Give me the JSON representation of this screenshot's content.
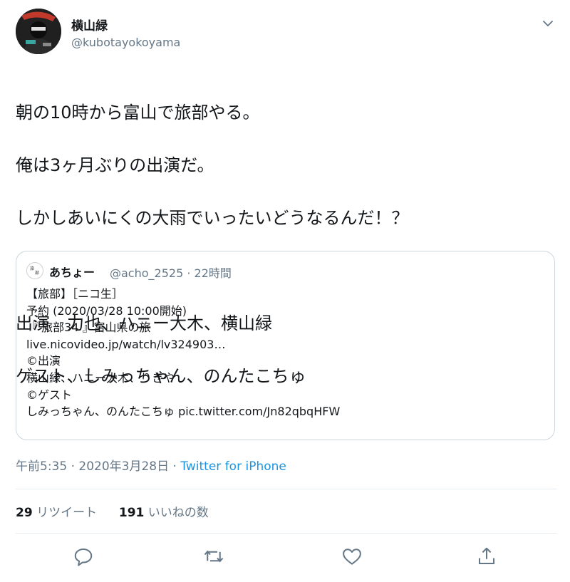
{
  "user": {
    "display_name": "横山緑",
    "handle": "@kubotayokoyama",
    "avatar_icon": "user-avatar-icon"
  },
  "tweet": {
    "lines": [
      "朝の10時から富山で旅部やる。",
      "俺は3ヶ月ぶりの出演だ。",
      "しかしあいにくの大雨でいったいどうなるんだ！？",
      "",
      "出演　力也、ハニー大木、横山緑",
      "ゲスト、しみっちゃん、のんたこちゅ"
    ]
  },
  "quote": {
    "name": "あちょー",
    "meta": "@acho_2525 · 22時間",
    "lines": [
      "【旅部】［ニコ生］",
      "予約 (2020/03/28 10:00開始)",
      "『 旅部34 』富山県の旅",
      "live.nicovideo.jp/watch/lv324903…",
      "©出演",
      "横山緑、ハニー大木、りきや",
      "©ゲスト",
      "しみっちゃん、のんたこちゅ pic.twitter.com/Jn82qbqHFW"
    ]
  },
  "timestamp": {
    "time": "午前5:35 · 2020年3月28日 · ",
    "source": "Twitter for iPhone"
  },
  "stats": {
    "retweet_count": "29",
    "retweet_label": "リツイート",
    "like_count": "191",
    "like_label": "いいねの数"
  },
  "actions": [
    "reply-icon",
    "retweet-icon",
    "like-icon",
    "share-icon"
  ],
  "colors": {
    "link": "#1b95e0",
    "muted": "#657786",
    "text": "#14171a",
    "border": "#ccd6dd"
  }
}
